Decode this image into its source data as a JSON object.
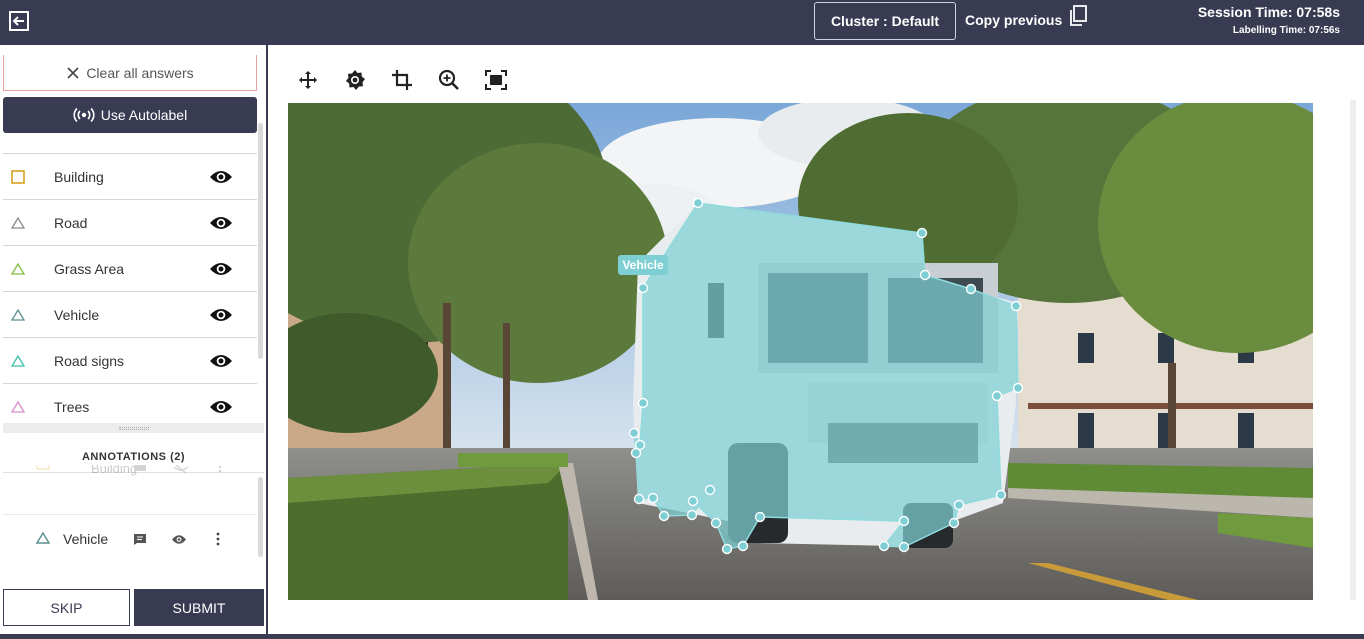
{
  "topbar": {
    "cluster_label": "Cluster : Default",
    "copy_previous_label": "Copy previous",
    "session_time": "Session Time: 07:58s",
    "labelling_time": "Labelling Time: 07:56s"
  },
  "sidebar": {
    "clear_label": "Clear all answers",
    "autolabel_label": "Use Autolabel",
    "labels": [
      {
        "name": "Building",
        "shape": "square",
        "color": "#d6a21e"
      },
      {
        "name": "Road",
        "shape": "triangle",
        "color": "#8a8a8a"
      },
      {
        "name": "Grass Area",
        "shape": "triangle",
        "color": "#7fbf3f"
      },
      {
        "name": "Vehicle",
        "shape": "triangle",
        "color": "#5a8f8f"
      },
      {
        "name": "Road signs",
        "shape": "triangle",
        "color": "#3fbfa8"
      },
      {
        "name": "Trees",
        "shape": "triangle",
        "color": "#d98ac9"
      }
    ],
    "annotations_header": "ANNOTATIONS (2)",
    "annotations": [
      {
        "name": "Building",
        "color": "#d6a21e"
      },
      {
        "name": "Vehicle",
        "color": "#5a8f8f"
      }
    ],
    "skip_label": "SKIP",
    "submit_label": "SUBMIT"
  },
  "canvas": {
    "annotation_label": "Vehicle",
    "polygon_color": "#7ecfd3"
  },
  "icons": {
    "exit": "exit-icon",
    "copy": "copy-icon",
    "clear": "close-icon",
    "autolabel": "broadcast-icon",
    "visibility": "eye-icon",
    "comment": "comment-icon",
    "more": "more-vertical-icon",
    "pan": "move-icon",
    "brightness": "brightness-icon",
    "crop": "crop-icon",
    "zoom": "zoom-in-icon",
    "fit": "fit-screen-icon"
  }
}
